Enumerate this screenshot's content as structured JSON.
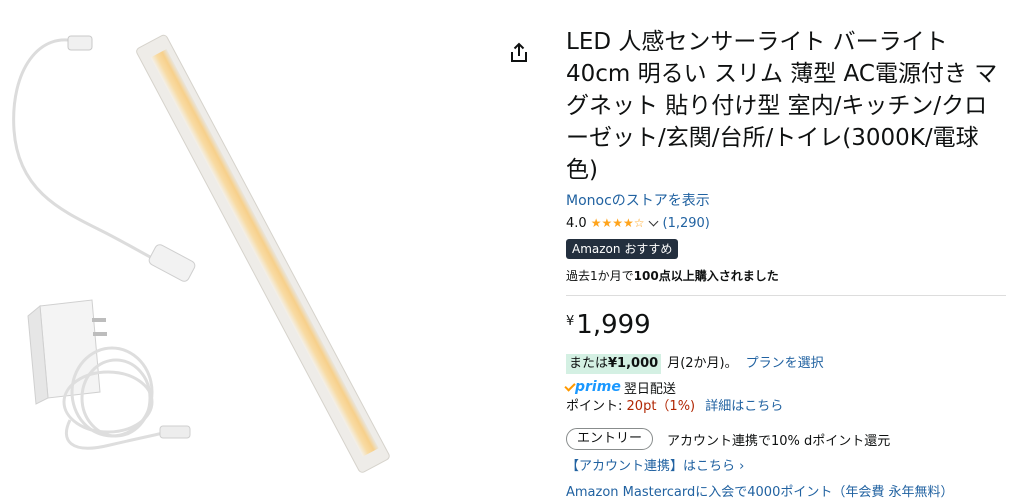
{
  "product": {
    "title": "LED 人感センサーライト バーライト 40cm 明るい スリム 薄型 AC電源付き マグネット 貼り付け型 室内/キッチン/クローゼット/玄関/台所/トイレ(3000K/電球色)",
    "store_link": "Monocのストアを表示",
    "rating_value": "4.0",
    "rating_stars": 4,
    "rating_count": "(1,290)",
    "badge": "Amazon おすすめ",
    "bought_prefix": "過去1か月で",
    "bought_bold": "100点以上購入されました",
    "suffix_bought": ""
  },
  "price": {
    "symbol": "¥",
    "amount": "1,999"
  },
  "installment": {
    "prefix": "または",
    "amount": "¥1,000",
    "suffix": "月(2か月)。",
    "plan_link": "プランを選択"
  },
  "prime": {
    "logo": "prime",
    "delivery": "翌日配送"
  },
  "points": {
    "label": "ポイント:",
    "value": "20pt（1%)",
    "detail_link": "詳細はこちら"
  },
  "dpoint": {
    "entry_label": "エントリー",
    "text": "アカウント連携で10% dポイント還元"
  },
  "account_link": "【アカウント連携】はこちら ›",
  "mastercard_text": "Amazon Mastercardに入会で4000ポイント（年会費 永年無料）",
  "colors": {
    "link": "#2162a1",
    "star": "#ffa41c",
    "price_red": "#b12704",
    "badge_bg": "#232f3e",
    "installment_bg": "#d4f0e3",
    "led_glow": "#f8dba3"
  },
  "icons": [
    "share-icon",
    "star-icon",
    "chevron-down-icon",
    "prime-check-icon"
  ]
}
